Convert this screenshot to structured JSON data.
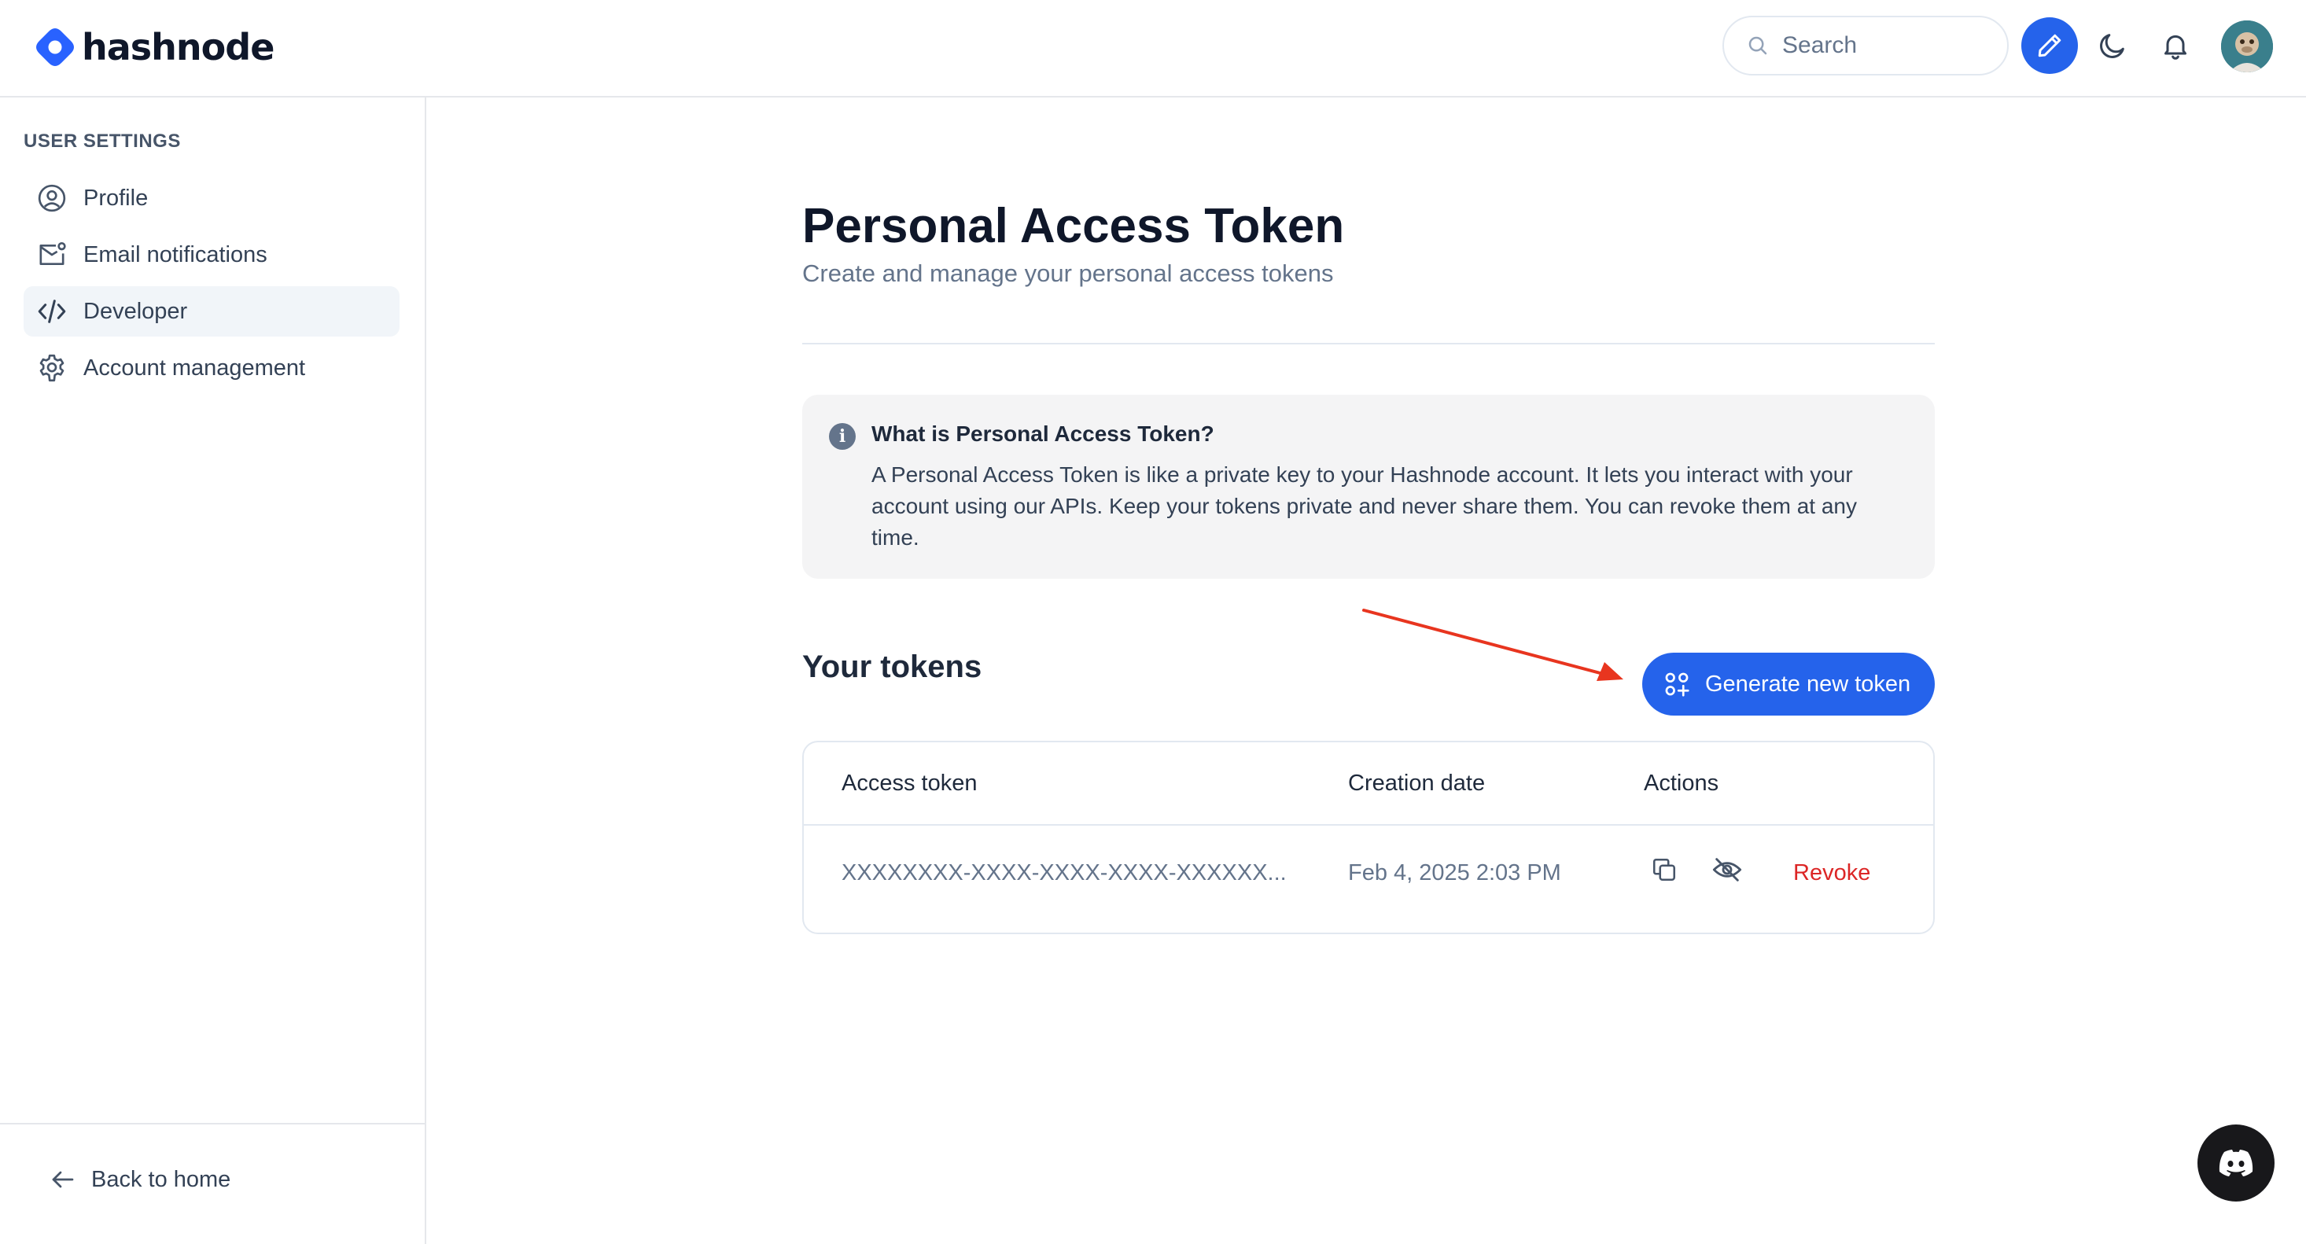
{
  "header": {
    "brand": "hashnode",
    "search_placeholder": "Search"
  },
  "sidebar": {
    "heading": "USER SETTINGS",
    "items": [
      {
        "label": "Profile",
        "icon": "user-circle-icon",
        "active": false
      },
      {
        "label": "Email notifications",
        "icon": "mail-notification-icon",
        "active": false
      },
      {
        "label": "Developer",
        "icon": "code-icon",
        "active": true
      },
      {
        "label": "Account management",
        "icon": "gear-icon",
        "active": false
      }
    ],
    "back_home": "Back to home"
  },
  "main": {
    "title": "Personal Access Token",
    "subtitle": "Create and manage your personal access tokens",
    "info": {
      "title": "What is Personal Access Token?",
      "body": "A Personal Access Token is like a private key to your Hashnode account. It lets you interact with your account using our APIs. Keep your tokens private and never share them. You can revoke them at any time."
    },
    "tokens_heading": "Your tokens",
    "generate_button": "Generate new token",
    "table": {
      "columns": [
        "Access token",
        "Creation date",
        "Actions"
      ],
      "rows": [
        {
          "token": "XXXXXXXX-XXXX-XXXX-XXXX-XXXXXX...",
          "created": "Feb 4, 2025 2:03 PM",
          "revoke": "Revoke"
        }
      ]
    }
  },
  "colors": {
    "accent": "#2563eb",
    "danger": "#dc2626",
    "annotation_arrow": "#e8351f"
  }
}
